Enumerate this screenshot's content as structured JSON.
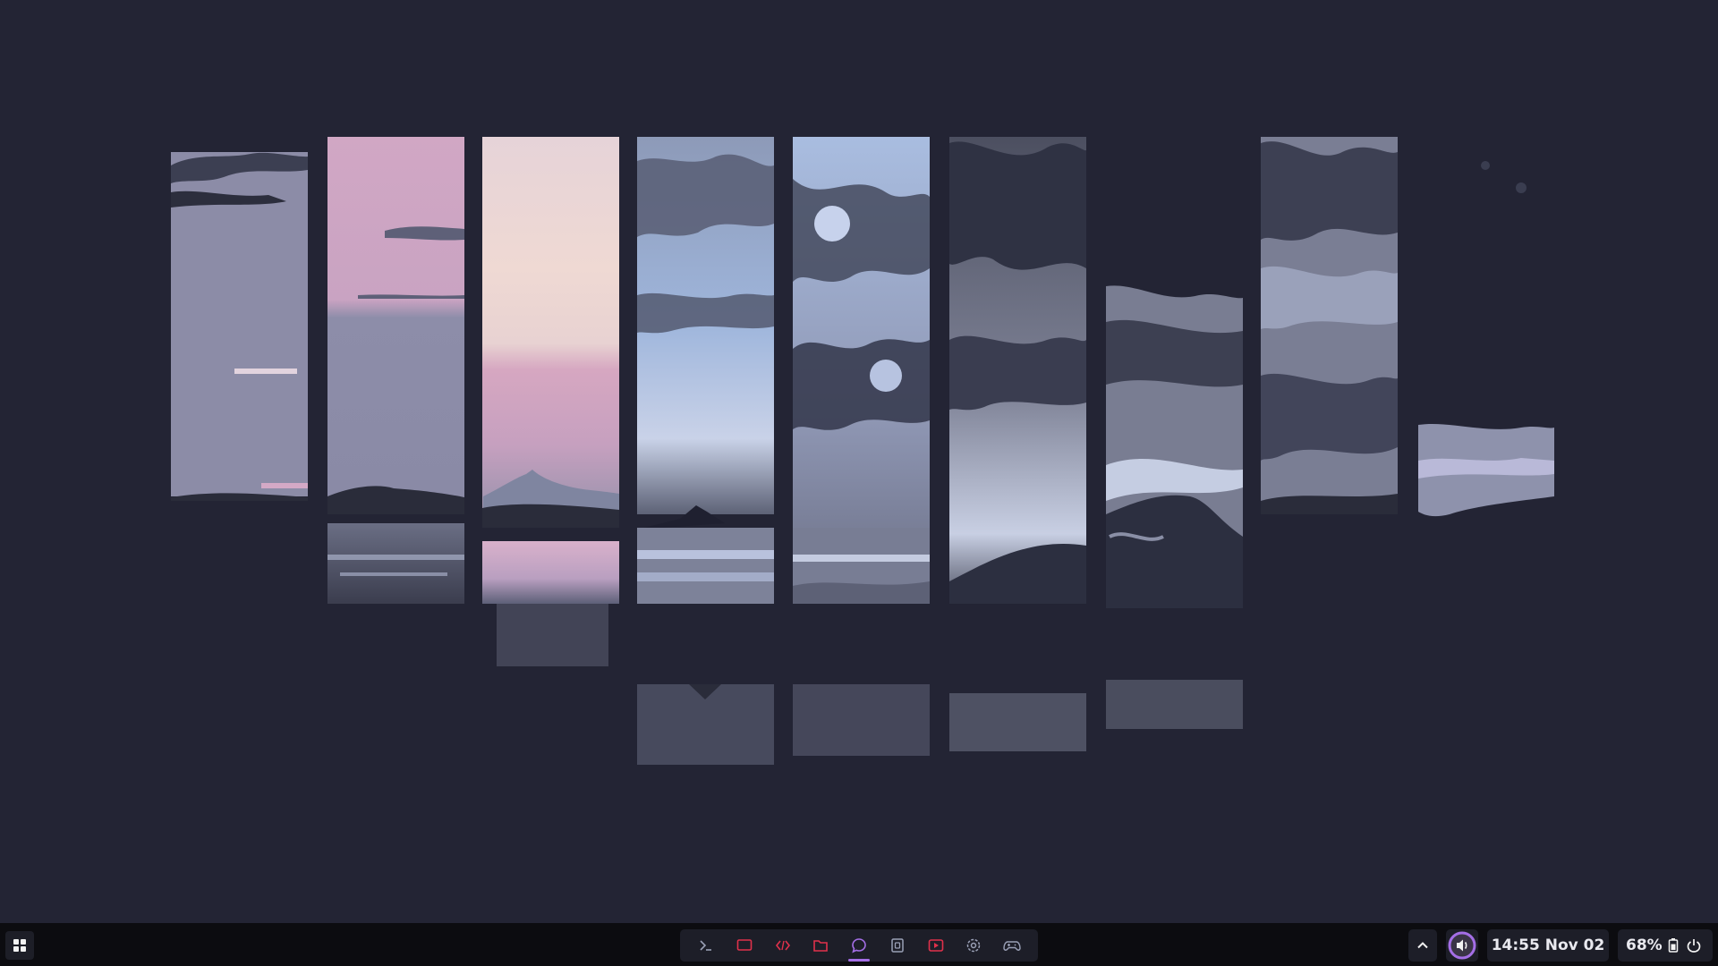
{
  "taskbar": {
    "clock": "14:55 Nov 02",
    "battery": "68%",
    "dock_items": [
      {
        "icon": "terminal-icon",
        "color": "#9aa0b6",
        "active": false
      },
      {
        "icon": "monitor-icon",
        "color": "#e0314b",
        "active": false
      },
      {
        "icon": "code-icon",
        "color": "#e0314b",
        "active": false
      },
      {
        "icon": "folder-icon",
        "color": "#e0314b",
        "active": false
      },
      {
        "icon": "chat-icon",
        "color": "#a46ee6",
        "active": true
      },
      {
        "icon": "notes-icon",
        "color": "#9aa0b6",
        "active": false
      },
      {
        "icon": "video-icon",
        "color": "#e0314b",
        "active": false
      },
      {
        "icon": "settings-icon",
        "color": "#9aa0b6",
        "active": false
      },
      {
        "icon": "gamepad-icon",
        "color": "#9aa0b6",
        "active": false
      }
    ]
  },
  "colors": {
    "background": "#232434",
    "taskbar": "#0c0c10",
    "accent": "#a46ee6",
    "accent_red": "#e0314b"
  }
}
